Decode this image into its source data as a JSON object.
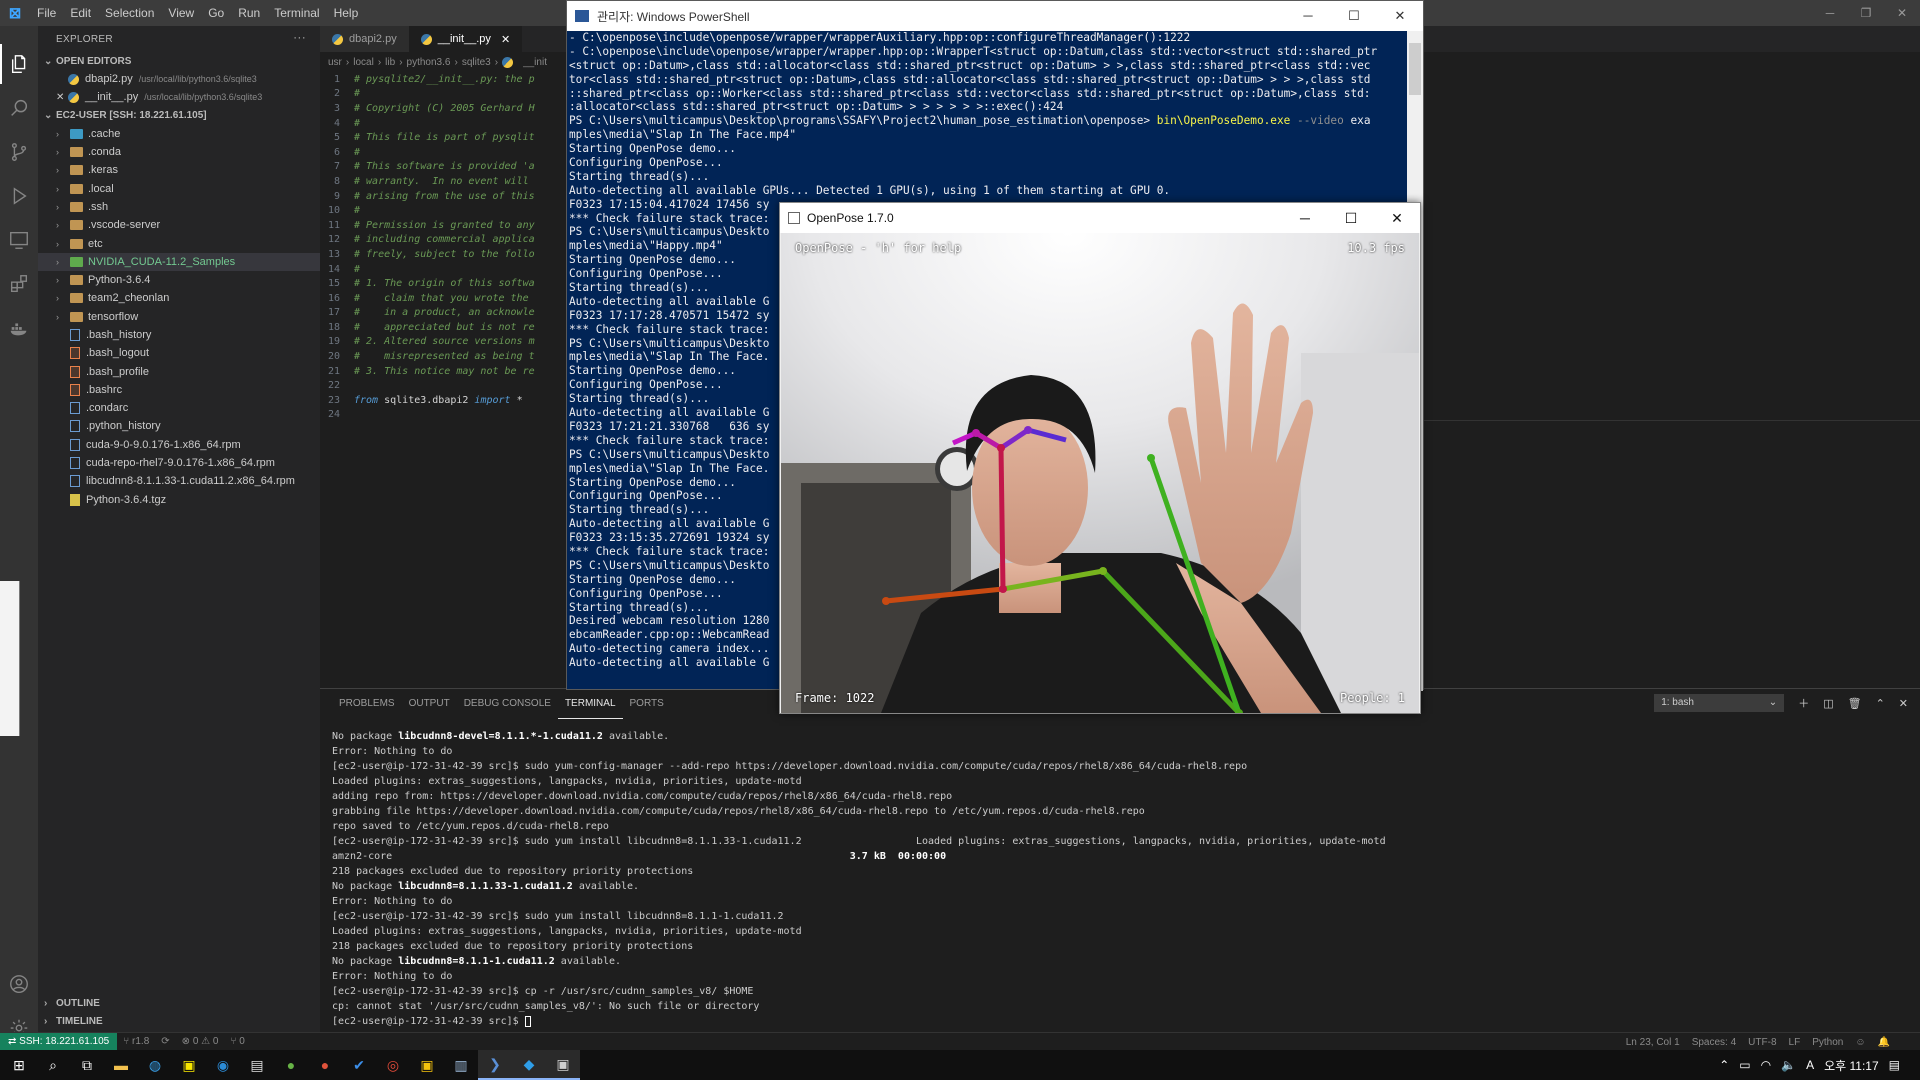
{
  "vscode": {
    "logo": "⊠",
    "menu": [
      "File",
      "Edit",
      "Selection",
      "View",
      "Go",
      "Run",
      "Terminal",
      "Help"
    ],
    "sidebar": {
      "title": "EXPLORER",
      "more": "···",
      "open_editors_label": "OPEN EDITORS",
      "open_editors": [
        {
          "name": "dbapi2.py",
          "path": "/usr/local/lib/python3.6/sqlite3"
        },
        {
          "name": "__init__.py",
          "path": "/usr/local/lib/python3.6/sqlite3"
        }
      ],
      "workspace_label": "EC2-USER [SSH: 18.221.61.105]",
      "tree": [
        {
          "name": ".cache",
          "kind": "folder-blue"
        },
        {
          "name": ".conda",
          "kind": "folder"
        },
        {
          "name": ".keras",
          "kind": "folder"
        },
        {
          "name": ".local",
          "kind": "folder"
        },
        {
          "name": ".ssh",
          "kind": "folder"
        },
        {
          "name": ".vscode-server",
          "kind": "folder"
        },
        {
          "name": "etc",
          "kind": "folder"
        },
        {
          "name": "NVIDIA_CUDA-11.2_Samples",
          "kind": "folder-green"
        },
        {
          "name": "Python-3.6.4",
          "kind": "folder"
        },
        {
          "name": "team2_cheonlan",
          "kind": "folder"
        },
        {
          "name": "tensorflow",
          "kind": "folder"
        },
        {
          "name": ".bash_history",
          "kind": "file"
        },
        {
          "name": ".bash_logout",
          "kind": "file-orange"
        },
        {
          "name": ".bash_profile",
          "kind": "file-orange"
        },
        {
          "name": ".bashrc",
          "kind": "file-orange"
        },
        {
          "name": ".condarc",
          "kind": "file"
        },
        {
          "name": ".python_history",
          "kind": "file"
        },
        {
          "name": "cuda-9-0-9.0.176-1.x86_64.rpm",
          "kind": "file"
        },
        {
          "name": "cuda-repo-rhel7-9.0.176-1.x86_64.rpm",
          "kind": "file"
        },
        {
          "name": "libcudnn8-8.1.1.33-1.cuda11.2.x86_64.rpm",
          "kind": "file"
        },
        {
          "name": "Python-3.6.4.tgz",
          "kind": "file-yellow"
        }
      ],
      "outline_label": "OUTLINE",
      "timeline_label": "TIMELINE"
    },
    "tabs": [
      {
        "label": "dbapi2.py",
        "active": false
      },
      {
        "label": "__init__.py",
        "active": true
      }
    ],
    "tab_close": "✕",
    "breadcrumb": [
      "usr",
      "local",
      "lib",
      "python3.6",
      "sqlite3",
      "__init"
    ],
    "code": [
      {
        "n": "1",
        "text": "# pysqlite2/__init__.py: the p",
        "type": "comment"
      },
      {
        "n": "2",
        "text": "#",
        "type": "comment"
      },
      {
        "n": "3",
        "text": "# Copyright (C) 2005 Gerhard H",
        "type": "comment"
      },
      {
        "n": "4",
        "text": "#",
        "type": "comment"
      },
      {
        "n": "5",
        "text": "# This file is part of pysqlit",
        "type": "comment"
      },
      {
        "n": "6",
        "text": "#",
        "type": "comment"
      },
      {
        "n": "7",
        "text": "# This software is provided 'a",
        "type": "comment"
      },
      {
        "n": "8",
        "text": "# warranty.  In no event will",
        "type": "comment"
      },
      {
        "n": "9",
        "text": "# arising from the use of this",
        "type": "comment"
      },
      {
        "n": "10",
        "text": "#",
        "type": "comment"
      },
      {
        "n": "11",
        "text": "# Permission is granted to any",
        "type": "comment"
      },
      {
        "n": "12",
        "text": "# including commercial applica",
        "type": "comment"
      },
      {
        "n": "13",
        "text": "# freely, subject to the follo",
        "type": "comment"
      },
      {
        "n": "14",
        "text": "#",
        "type": "comment"
      },
      {
        "n": "15",
        "text": "# 1. The origin of this softwa",
        "type": "comment"
      },
      {
        "n": "16",
        "text": "#    claim that you wrote the",
        "type": "comment"
      },
      {
        "n": "17",
        "text": "#    in a product, an acknowle",
        "type": "comment"
      },
      {
        "n": "18",
        "text": "#    appreciated but is not re",
        "type": "comment"
      },
      {
        "n": "19",
        "text": "# 2. Altered source versions m",
        "type": "comment"
      },
      {
        "n": "20",
        "text": "#    misrepresented as being t",
        "type": "comment"
      },
      {
        "n": "21",
        "text": "# 3. This notice may not be re",
        "type": "comment"
      },
      {
        "n": "22",
        "text": "",
        "type": "plain"
      },
      {
        "n": "23",
        "text": "from sqlite3.dbapi2 import *",
        "type": "import"
      },
      {
        "n": "24",
        "text": "",
        "type": "plain"
      }
    ],
    "panel": {
      "tabs": [
        "PROBLEMS",
        "OUTPUT",
        "DEBUG CONSOLE",
        "TERMINAL",
        "PORTS"
      ],
      "active_tab": "TERMINAL",
      "shell": "1: bash",
      "terminal_lines": [
        "No package |libcudnn8-devel=8.1.1.*-1.cuda11.2| available.",
        "Error: Nothing to do",
        "[ec2-user@ip-172-31-42-39 src]$ sudo yum-config-manager --add-repo https://developer.download.nvidia.com/compute/cuda/repos/rhel8/x86_64/cuda-rhel8.repo",
        "Loaded plugins: extras_suggestions, langpacks, nvidia, priorities, update-motd",
        "adding repo from: https://developer.download.nvidia.com/compute/cuda/repos/rhel8/x86_64/cuda-rhel8.repo",
        "grabbing file https://developer.download.nvidia.com/compute/cuda/repos/rhel8/x86_64/cuda-rhel8.repo to /etc/yum.repos.d/cuda-rhel8.repo",
        "repo saved to /etc/yum.repos.d/cuda-rhel8.repo",
        "[ec2-user@ip-172-31-42-39 src]$ sudo yum install libcudnn8=8.1.1.33-1.cuda11.2                   Loaded plugins: extras_suggestions, langpacks, nvidia, priorities, update-motd",
        "amzn2-core                                                                           | 3.7 kB  00:00:00",
        "218 packages excluded due to repository priority protections",
        "No package |libcudnn8=8.1.1.33-1.cuda11.2| available.",
        "Error: Nothing to do",
        "[ec2-user@ip-172-31-42-39 src]$ sudo yum install libcudnn8=8.1.1-1.cuda11.2",
        "Loaded plugins: extras_suggestions, langpacks, nvidia, priorities, update-motd",
        "218 packages excluded due to repository priority protections",
        "No package |libcudnn8=8.1.1-1.cuda11.2| available.",
        "Error: Nothing to do",
        "[ec2-user@ip-172-31-42-39 src]$ cp -r /usr/src/cudnn_samples_v8/ $HOME",
        "cp: cannot stat '/usr/src/cudnn_samples_v8/': No such file or directory",
        "[ec2-user@ip-172-31-42-39 src]$ "
      ]
    },
    "status": {
      "remote": "SSH: 18.221.61.105",
      "branch": "r1.8",
      "errors": "⊗ 0 ⚠ 0",
      "ports": "⑂ 0",
      "right": [
        "Ln 23, Col 1",
        "Spaces: 4",
        "UTF-8",
        "LF",
        "Python"
      ]
    }
  },
  "powershell": {
    "title": "관리자: Windows PowerShell",
    "lines": [
      "- C:\\openpose\\include\\openpose/wrapper/wrapperAuxiliary.hpp:op::configureThreadManager():1222",
      "- C:\\openpose\\include\\openpose/wrapper/wrapper.hpp:op::WrapperT<struct op::Datum,class std::vector<struct std::shared_ptr",
      "<struct op::Datum>,class std::allocator<class std::shared_ptr<struct op::Datum> > >,class std::shared_ptr<class std::vec",
      "tor<class std::shared_ptr<struct op::Datum>,class std::allocator<class std::shared_ptr<struct op::Datum> > > >,class std",
      "::shared_ptr<class op::Worker<class std::shared_ptr<class std::vector<class std::shared_ptr<struct op::Datum>,class std:",
      ":allocator<class std::shared_ptr<struct op::Datum> > > > > > >::exec():424",
      "PS C:\\Users\\multicampus\\Desktop\\programs\\SSAFY\\Project2\\human_pose_estimation\\openpose> |bin\\OpenPoseDemo.exe| --video |exa",
      "mples\\media\\\"Slap In The Face.mp4\"",
      "Starting OpenPose demo...",
      "Configuring OpenPose...",
      "Starting thread(s)...",
      "Auto-detecting all available GPUs... Detected 1 GPU(s), using 1 of them starting at GPU 0.",
      "F0323 17:15:04.417024 17456 sy",
      "*** Check failure stack trace:",
      "PS C:\\Users\\multicampus\\Deskto",
      "mples\\media\\\"Happy.mp4\"",
      "Starting OpenPose demo...",
      "Configuring OpenPose...",
      "Starting thread(s)...",
      "Auto-detecting all available G",
      "F0323 17:17:28.470571 15472 sy",
      "*** Check failure stack trace:",
      "PS C:\\Users\\multicampus\\Deskto",
      "mples\\media\\\"Slap In The Face.",
      "Starting OpenPose demo...",
      "Configuring OpenPose...",
      "Starting thread(s)...",
      "Auto-detecting all available G",
      "F0323 17:21:21.330768   636 sy",
      "*** Check failure stack trace:",
      "PS C:\\Users\\multicampus\\Deskto",
      "mples\\media\\\"Slap In The Face.",
      "Starting OpenPose demo...",
      "Configuring OpenPose...",
      "Starting thread(s)...",
      "Auto-detecting all available G",
      "F0323 23:15:35.272691 19324 sy",
      "*** Check failure stack trace:",
      "PS C:\\Users\\multicampus\\Deskto",
      "Starting OpenPose demo...",
      "Configuring OpenPose...",
      "Starting thread(s)...",
      "Desired webcam resolution 1280",
      "ebcamReader.cpp:op::WebcamRead",
      "Auto-detecting camera index...",
      "Auto-detecting all available G"
    ]
  },
  "openpose": {
    "title": "OpenPose 1.7.0",
    "help_text": "OpenPose - 'h' for help",
    "fps": "10.3 fps",
    "frame": "Frame: 1022",
    "people": "People: 1"
  },
  "taskbar": {
    "icons": [
      "start",
      "search",
      "task-view",
      "file-explorer",
      "edge",
      "kakaotalk",
      "app-blue",
      "notepad",
      "app-green",
      "app-red",
      "app-checkmark",
      "chrome",
      "app-yellow",
      "app-window",
      "powershell",
      "vscode",
      "openpose"
    ],
    "ime": "A",
    "time": "오후 11:17"
  }
}
